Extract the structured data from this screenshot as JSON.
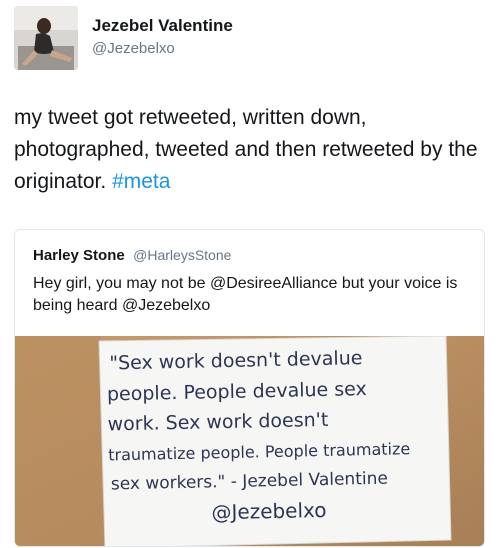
{
  "author": {
    "name": "Jezebel Valentine",
    "handle": "@Jezebelxo"
  },
  "tweet": {
    "text_main": "my tweet got retweeted, written down, photographed, tweeted and then retweeted by the originator.",
    "hashtag": "#meta"
  },
  "quoted_tweet": {
    "name": "Harley Stone",
    "handle": "@HarleysStone",
    "text": "Hey girl, you may not be @DesireeAlliance but your voice is being heard @Jezebelxo"
  },
  "photo_note": {
    "lines": [
      "\"Sex work doesn't devalue",
      "people. People devalue sex",
      "work. Sex work doesn't",
      "traumatize people. People traumatize",
      "sex workers.\" - Jezebel Valentine",
      "@Jezebelxo"
    ]
  },
  "colors": {
    "link": "#1b95e0",
    "secondary_text": "#657786",
    "border": "#e1e8ed",
    "ink": "#2c3556"
  }
}
